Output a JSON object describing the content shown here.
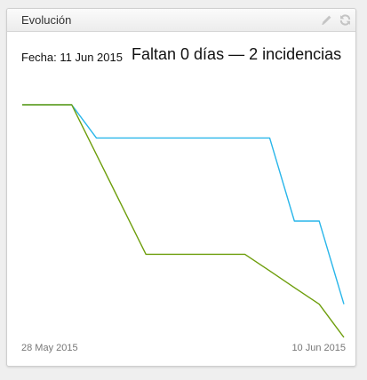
{
  "widget": {
    "title": "Evolución",
    "edit_icon": "pencil-icon",
    "refresh_icon": "refresh-icon"
  },
  "info": {
    "date_label": "Fecha:",
    "date_value": "11 Jun 2015",
    "headline": "Faltan 0 días — 2 incidencias"
  },
  "colors": {
    "series_blue": "#29b6ea",
    "series_green": "#6e9e0c",
    "icon": "#c4c4c4"
  },
  "chart_data": {
    "type": "line",
    "xlabel": "",
    "ylabel": "",
    "x_start_label": "28 May 2015",
    "x_end_label": "10 Jun 2015",
    "x": [
      "28 May 2015",
      "29 May 2015",
      "30 May 2015",
      "31 May 2015",
      "1 Jun 2015",
      "2 Jun 2015",
      "3 Jun 2015",
      "4 Jun 2015",
      "5 Jun 2015",
      "6 Jun 2015",
      "7 Jun 2015",
      "8 Jun 2015",
      "9 Jun 2015",
      "10 Jun 2015"
    ],
    "series": [
      {
        "color": "#29b6ea",
        "values": [
          14,
          14,
          14,
          12,
          12,
          12,
          12,
          12,
          12,
          12,
          12,
          7,
          7,
          2
        ]
      },
      {
        "color": "#6e9e0c",
        "values": [
          14,
          14,
          14,
          11,
          8,
          5,
          5,
          5,
          5,
          5,
          4,
          3,
          2,
          0
        ]
      }
    ],
    "ylim": [
      0,
      14
    ],
    "grid": false,
    "legend": "none"
  }
}
